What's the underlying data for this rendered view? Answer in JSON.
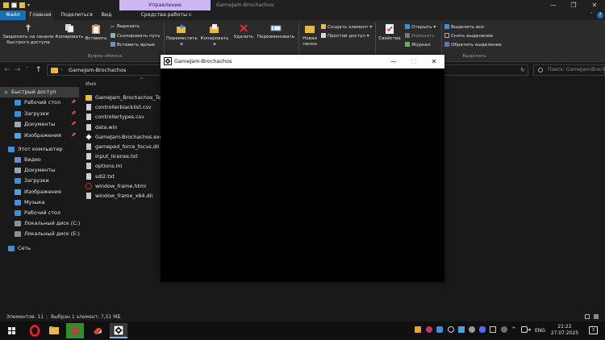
{
  "titlebar": {
    "manage_tab": "Управление",
    "window_title": "GameJam-Brochachos",
    "minimize": "—",
    "maximize": "❐",
    "close": "✕"
  },
  "tabs": {
    "file": "Файл",
    "home": "Главная",
    "share": "Поделиться",
    "view": "Вид",
    "app_tools": "Средства работы с приложениями"
  },
  "ribbon": {
    "pin_line1": "Закрепить на панели",
    "pin_line2": "быстрого доступа",
    "copy": "Копировать",
    "paste": "Вставить",
    "cut": "Вырезать",
    "copy_path": "Скопировать путь",
    "paste_shortcut": "Вставить ярлык",
    "clipboard_group": "Буфер обмена",
    "move_to_line1": "Переместить",
    "move_to_line2": "в",
    "copy_to_line1": "Копировать",
    "copy_to_line2": "в",
    "delete": "Удалить",
    "rename": "Переименовать",
    "new_folder_line1": "Новая",
    "new_folder_line2": "папка",
    "new_item": "Создать элемент",
    "easy_access": "Простой доступ",
    "properties": "Свойства",
    "open": "Открыть",
    "edit": "Изменить",
    "history": "Журнал",
    "select_all": "Выделить все",
    "select_none": "Снять выделение",
    "invert_selection": "Обратить выделение",
    "select_group": "Выделить"
  },
  "address": {
    "path": "GameJam-Brochachos",
    "search_placeholder": "Поиск: GameJam-Brochachos"
  },
  "nav": {
    "quick_access": "Быстрый доступ",
    "quick": [
      {
        "label": "Рабочий стол",
        "icon": "desktop-icon",
        "color": "#3d8fd6"
      },
      {
        "label": "Загрузки",
        "icon": "downloads-icon",
        "color": "#3d8fd6"
      },
      {
        "label": "Документы",
        "icon": "documents-icon",
        "color": "#9aa7b5"
      },
      {
        "label": "Изображения",
        "icon": "pictures-icon",
        "color": "#5aa0d8"
      }
    ],
    "this_pc": "Этот компьютер",
    "pc": [
      {
        "label": "Видео",
        "icon": "videos-icon",
        "color": "#6d8fc9"
      },
      {
        "label": "Документы",
        "icon": "documents-icon",
        "color": "#9aa7b5"
      },
      {
        "label": "Загрузки",
        "icon": "downloads-icon",
        "color": "#3d8fd6"
      },
      {
        "label": "Изображения",
        "icon": "pictures-icon",
        "color": "#5aa0d8"
      },
      {
        "label": "Музыка",
        "icon": "music-icon",
        "color": "#4a90d9"
      },
      {
        "label": "Рабочий стол",
        "icon": "desktop-icon",
        "color": "#3d8fd6"
      },
      {
        "label": "Локальный диск (C:)",
        "icon": "drive-icon",
        "color": "#8a9299"
      },
      {
        "label": "Локальный диск (E:)",
        "icon": "drive-icon",
        "color": "#8a9299"
      }
    ],
    "network": "Сеть"
  },
  "files": {
    "column_name": "Имя",
    "sort_indicator": "^",
    "items": [
      {
        "name": "GameJam_Brochachos_Text",
        "icon": "folder-icon",
        "color": "#e8b94a"
      },
      {
        "name": "controllerblacklist.csv",
        "icon": "csv-file-icon",
        "color": "#d0d0d0"
      },
      {
        "name": "controllertypes.csv",
        "icon": "csv-file-icon",
        "color": "#d0d0d0"
      },
      {
        "name": "data.win",
        "icon": "file-icon",
        "color": "#d0d0d0"
      },
      {
        "name": "GameJam-Brochachos.exe",
        "icon": "game-exe-icon",
        "color": "#ffffff"
      },
      {
        "name": "gamepad_force_focus.dll",
        "icon": "dll-file-icon",
        "color": "#c8c8c8"
      },
      {
        "name": "input_license.txt",
        "icon": "text-file-icon",
        "color": "#d0d0d0"
      },
      {
        "name": "options.ini",
        "icon": "ini-file-icon",
        "color": "#c8c8c8"
      },
      {
        "name": "sdl2.txt",
        "icon": "text-file-icon",
        "color": "#d0d0d0"
      },
      {
        "name": "window_frame.html",
        "icon": "html-file-icon",
        "color": "#c62828"
      },
      {
        "name": "window_frame_x64.dll",
        "icon": "dll-file-icon",
        "color": "#c8c8c8"
      }
    ]
  },
  "status": {
    "count": "Элементов: 11",
    "selected": "Выбран 1 элемент: 7,51 МБ"
  },
  "game_window": {
    "title": "GameJam-Brochachos",
    "minimize": "—",
    "maximize": "☐",
    "close": "✕"
  },
  "taskbar": {
    "language": "ENG",
    "time": "21:22",
    "date": "27.07.2025",
    "notifications": "3"
  },
  "colors": {
    "accent": "#1a6fb3",
    "manage_tab": "#cdb7f2",
    "folder": "#e8b94a",
    "background": "#191919"
  }
}
